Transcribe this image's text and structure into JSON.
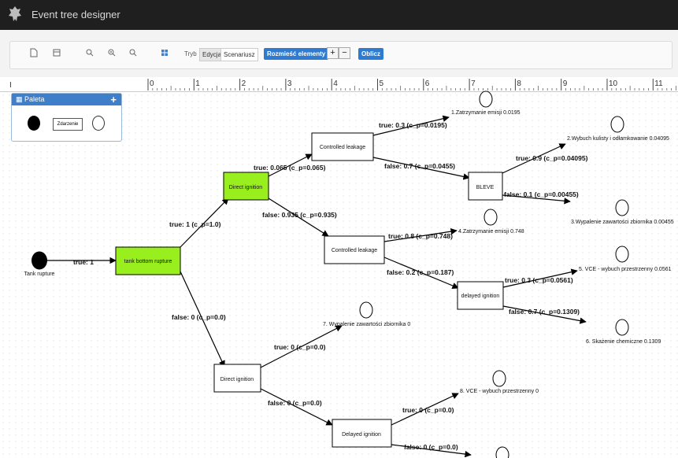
{
  "app": {
    "title": "Event tree designer"
  },
  "toolbar": {
    "mode_label": "Tryb",
    "mode_edit": "Edycja",
    "mode_scenario": "Scenariusz",
    "arrange_button": "Rozmieść elementy",
    "plus": "+",
    "minus": "−",
    "compute_button": "Oblicz",
    "icons": [
      "new-file-icon",
      "save-icon",
      "zoom-in-icon",
      "zoom-fit-icon",
      "zoom-out-icon",
      "grid-icon"
    ]
  },
  "ruler": {
    "numbers": [
      "0",
      "1",
      "2",
      "3",
      "4",
      "5",
      "6",
      "7",
      "8",
      "9",
      "10",
      "11"
    ]
  },
  "palette": {
    "title": "Paleta",
    "plus": "+",
    "event_label": "Zdarzenie"
  },
  "diagram": {
    "initiator": "Tank rupture",
    "nodes": {
      "n1": "tank bottom rupture",
      "n2": "Direct ignition",
      "n3": "Controlled leakage",
      "n4": "BLEVE",
      "n5": "Controlled leakage",
      "n6": "delayed ignition",
      "n7": "Direct ignition",
      "n8": "Delayed ignition"
    },
    "branches": {
      "b_init": "true: 1",
      "b_n1_true": "true: 1 (c_p=1.0)",
      "b_n1_false": "false: 0 (c_p=0.0)",
      "b_n2_true": "true: 0.065 (c_p=0.065)",
      "b_n2_false": "false: 0.935 (c_p=0.935)",
      "b_n3_true": "true: 0.3 (c_p=0.0195)",
      "b_n3_false": "false: 0.7 (c_p=0.0455)",
      "b_n4_true": "true: 0.9 (c_p=0.04095)",
      "b_n4_false": "false: 0.1 (c_p=0.00455)",
      "b_n5_true": "true: 0.8 (c_p=0.748)",
      "b_n5_false": "false: 0.2 (c_p=0.187)",
      "b_n6_true": "true: 0.3 (c_p=0.0561)",
      "b_n6_false": "false: 0.7 (c_p=0.1309)",
      "b_n7_true": "true: 0 (c_p=0.0)",
      "b_n7_false": "false: 0 (c_p=0.0)",
      "b_n8_true": "true: 0 (c_p=0.0)",
      "b_n8_false": "false: 0 (c_p=0.0)"
    },
    "outcomes": {
      "o1": "1.Zatrzymanie emisji 0.0195",
      "o2": "2.Wybuch kulisty i odłamkowanie 0.04095",
      "o3": "3.Wypalenie zawartości zbiornika 0.00455",
      "o4": "4.Zatrzymanie emisji 0.748",
      "o5": "5. VCE - wybuch przestrzenny 0.0561",
      "o6": "6. Skażenie chemiczne 0.1309",
      "o7": "7. Wypalenie zawartości zbiornika 0",
      "o8": "8. VCE - wybuch przestrzenny 0"
    },
    "colors": {
      "highlight": "#99ee1e",
      "line": "#000000"
    }
  }
}
